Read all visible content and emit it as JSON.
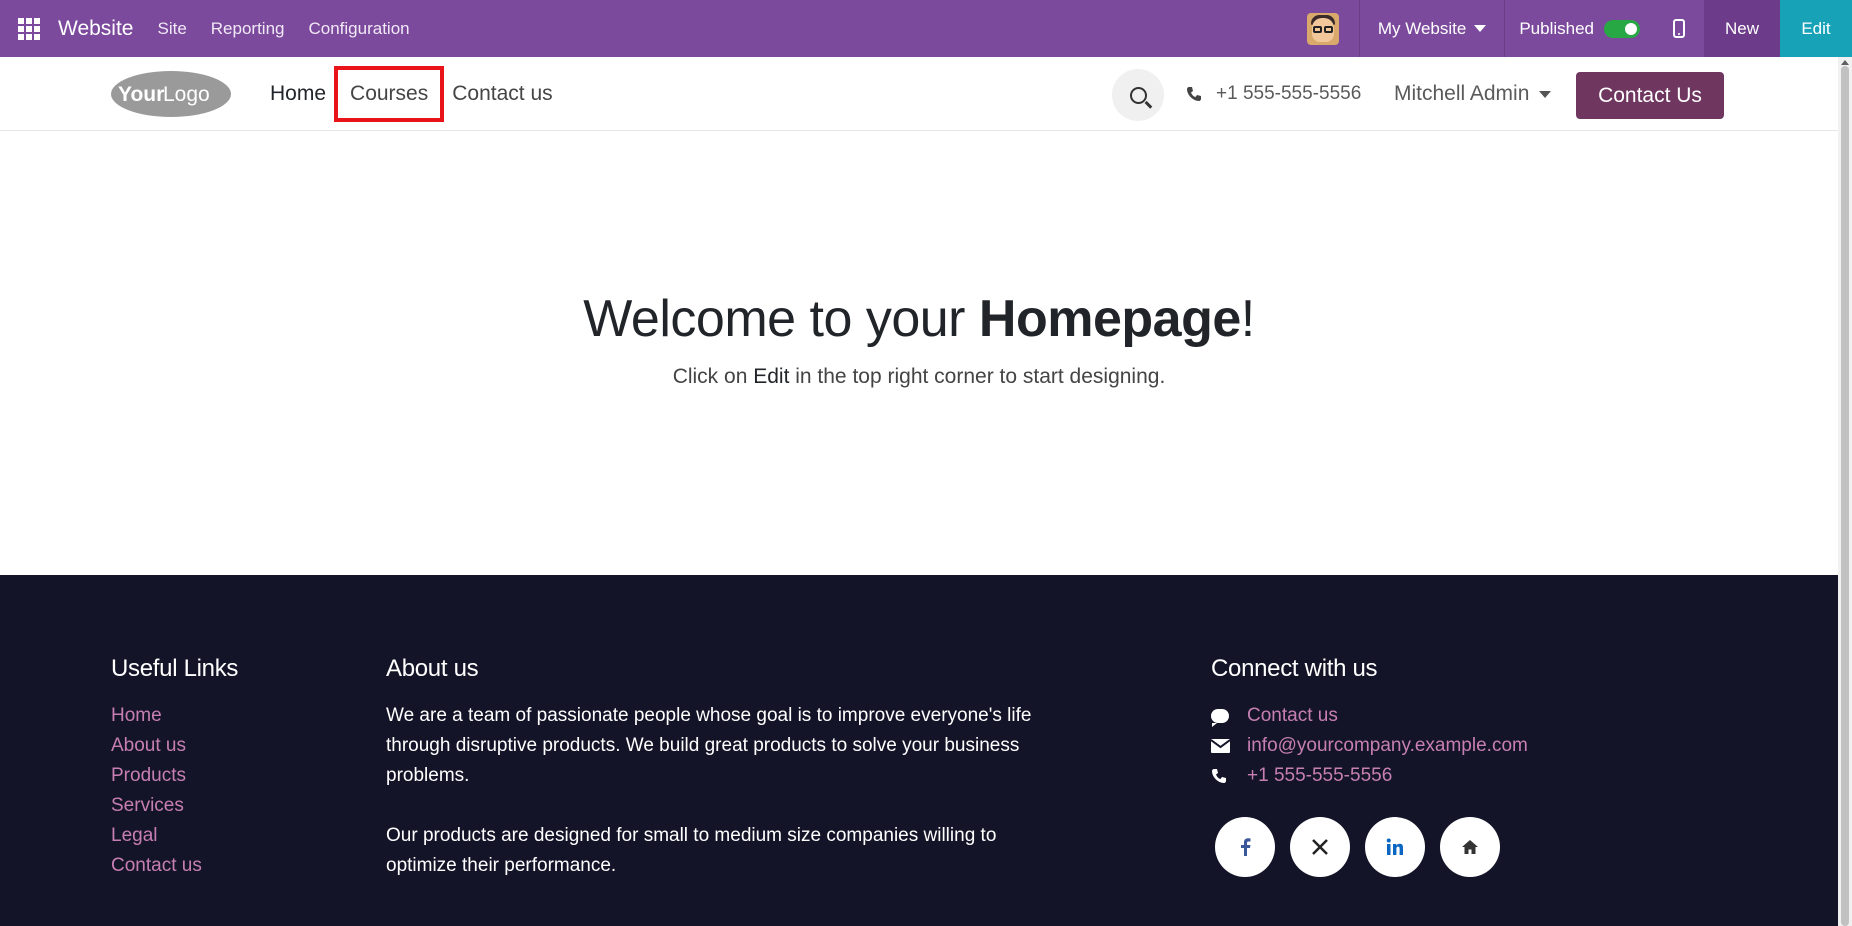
{
  "topbar": {
    "brand": "Website",
    "menu": [
      "Site",
      "Reporting",
      "Configuration"
    ],
    "website_selector": "My Website",
    "published_label": "Published",
    "published": true,
    "new_label": "New",
    "edit_label": "Edit",
    "bar_color": "#7c4a9c",
    "edit_color": "#17a2b8"
  },
  "header": {
    "logo_text_a": "Your",
    "logo_text_b": "Logo",
    "nav": [
      "Home",
      "Courses",
      "Contact us"
    ],
    "highlighted_nav": "Courses",
    "phone": "+1 555-555-5556",
    "user": "Mitchell Admin",
    "cta": "Contact Us",
    "cta_color": "#6f3660",
    "highlight_color": "#e8141a"
  },
  "main": {
    "welcome_prefix": "Welcome to your ",
    "welcome_bold": "Homepage",
    "welcome_suffix": "!",
    "sub_a": "Click on ",
    "sub_em": "Edit",
    "sub_b": " in the top right corner to start designing."
  },
  "footer": {
    "useful_title": "Useful Links",
    "useful_links": [
      "Home",
      "About us",
      "Products",
      "Services",
      "Legal",
      "Contact us"
    ],
    "about_title": "About us",
    "about_p1": "We are a team of passionate people whose goal is to improve everyone's life through disruptive products. We build great products to solve your business problems.",
    "about_p2": "Our products are designed for small to medium size companies willing to optimize their performance.",
    "connect_title": "Connect with us",
    "connect_contact": "Contact us",
    "connect_email": "info@yourcompany.example.com",
    "connect_phone": "+1 555-555-5556",
    "social": [
      "facebook-icon",
      "x-icon",
      "linkedin-icon",
      "home-icon"
    ],
    "bg_color": "#131428",
    "link_color": "#c77fb3"
  }
}
